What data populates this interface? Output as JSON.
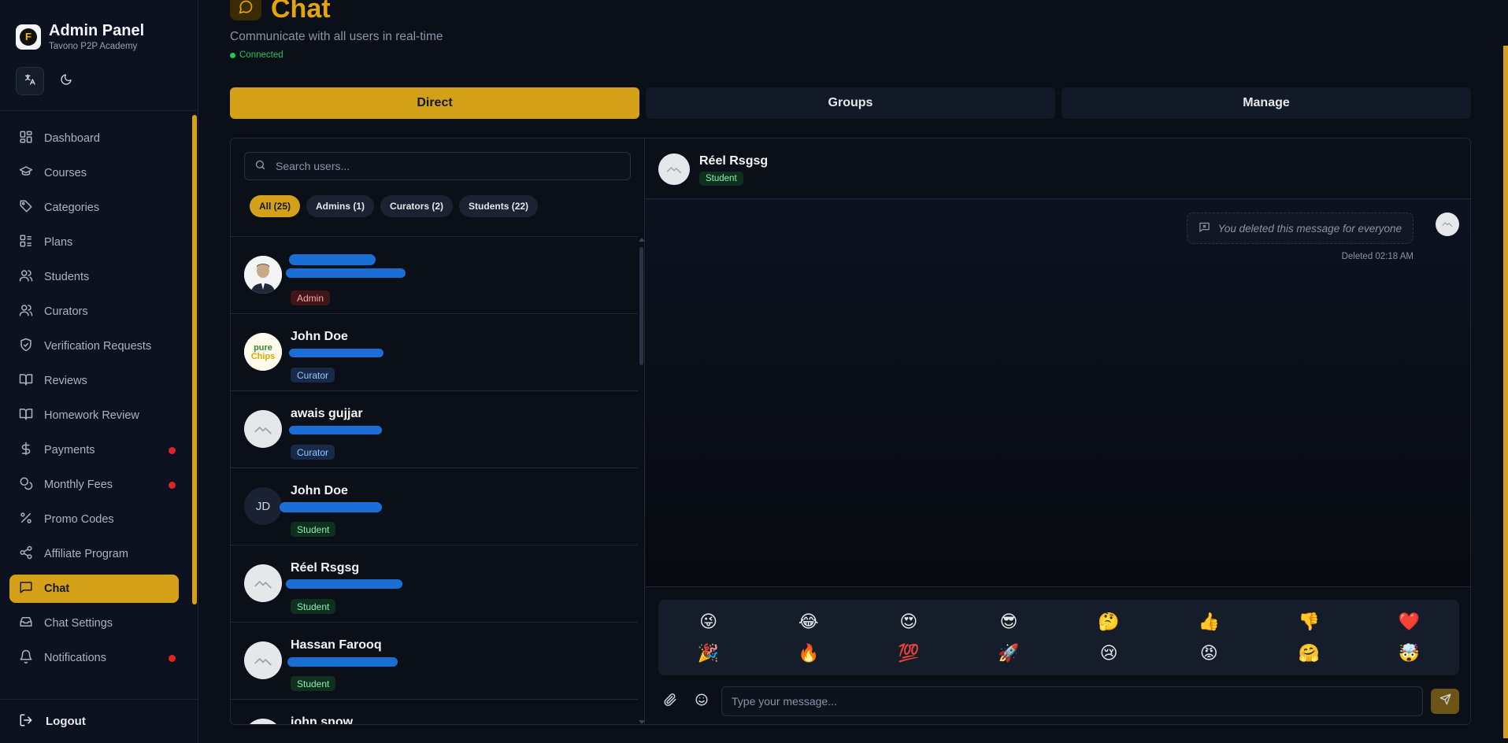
{
  "sidebar": {
    "brand": {
      "title": "Admin Panel",
      "subtitle": "Tavono P2P Academy",
      "logo_letter": "F"
    },
    "tools": [
      {
        "icon": "translate-icon"
      },
      {
        "icon": "moon-icon"
      }
    ],
    "items": [
      {
        "label": "Dashboard",
        "icon": "dashboard-icon"
      },
      {
        "label": "Courses",
        "icon": "graduation-cap-icon"
      },
      {
        "label": "Categories",
        "icon": "tag-icon"
      },
      {
        "label": "Plans",
        "icon": "list-icon"
      },
      {
        "label": "Students",
        "icon": "users-icon"
      },
      {
        "label": "Curators",
        "icon": "users-icon"
      },
      {
        "label": "Verification Requests",
        "icon": "shield-check-icon"
      },
      {
        "label": "Reviews",
        "icon": "book-open-icon"
      },
      {
        "label": "Homework Review",
        "icon": "book-open-icon"
      },
      {
        "label": "Payments",
        "icon": "dollar-icon",
        "notification": true
      },
      {
        "label": "Monthly Fees",
        "icon": "coins-icon",
        "notification": true
      },
      {
        "label": "Promo Codes",
        "icon": "percent-icon"
      },
      {
        "label": "Affiliate Program",
        "icon": "share-icon"
      },
      {
        "label": "Chat",
        "icon": "chat-bubble-icon",
        "active": true
      },
      {
        "label": "Chat Settings",
        "icon": "archive-icon"
      },
      {
        "label": "Notifications",
        "icon": "bell-icon",
        "notification": true
      }
    ],
    "logout_label": "Logout"
  },
  "header": {
    "title": "Chat",
    "subtitle": "Communicate with all users in real-time",
    "status": "Connected"
  },
  "tabs": [
    {
      "label": "Direct",
      "active": true
    },
    {
      "label": "Groups"
    },
    {
      "label": "Manage"
    }
  ],
  "users_panel": {
    "search_placeholder": "Search users...",
    "filters": [
      {
        "label": "All (25)",
        "active": true
      },
      {
        "label": "Admins (1)"
      },
      {
        "label": "Curators (2)"
      },
      {
        "label": "Students (22)"
      }
    ],
    "users": [
      {
        "name": "",
        "role": "Admin",
        "avatar": "photo"
      },
      {
        "name": "John Doe",
        "role": "Curator",
        "avatar": "logo"
      },
      {
        "name": "awais gujjar",
        "role": "Curator",
        "avatar": "placeholder"
      },
      {
        "name": "John Doe",
        "role": "Student",
        "avatar": "initials",
        "initials": "JD"
      },
      {
        "name": "Réel Rsgsg",
        "role": "Student",
        "avatar": "placeholder"
      },
      {
        "name": "Hassan Farooq",
        "role": "Student",
        "avatar": "placeholder"
      },
      {
        "name": "john snow",
        "role": "",
        "avatar": "placeholder"
      }
    ]
  },
  "conversation": {
    "name": "Réel Rsgsg",
    "role": "Student",
    "messages": [
      {
        "text": "You deleted this message for everyone",
        "time": "Deleted 02:18 AM"
      }
    ],
    "emojis": [
      "😜",
      "😂",
      "😍",
      "😎",
      "🤔",
      "👍",
      "👎",
      "❤️",
      "🎉",
      "🔥",
      "💯",
      "🚀",
      "😢",
      "😡",
      "🤗",
      "🤯"
    ],
    "input_placeholder": "Type your message..."
  },
  "colors": {
    "accent": "#d4a017",
    "background": "#0b0f17",
    "sidebar": "#0d1220",
    "notification": "#dc2626",
    "online": "#22c55e"
  }
}
